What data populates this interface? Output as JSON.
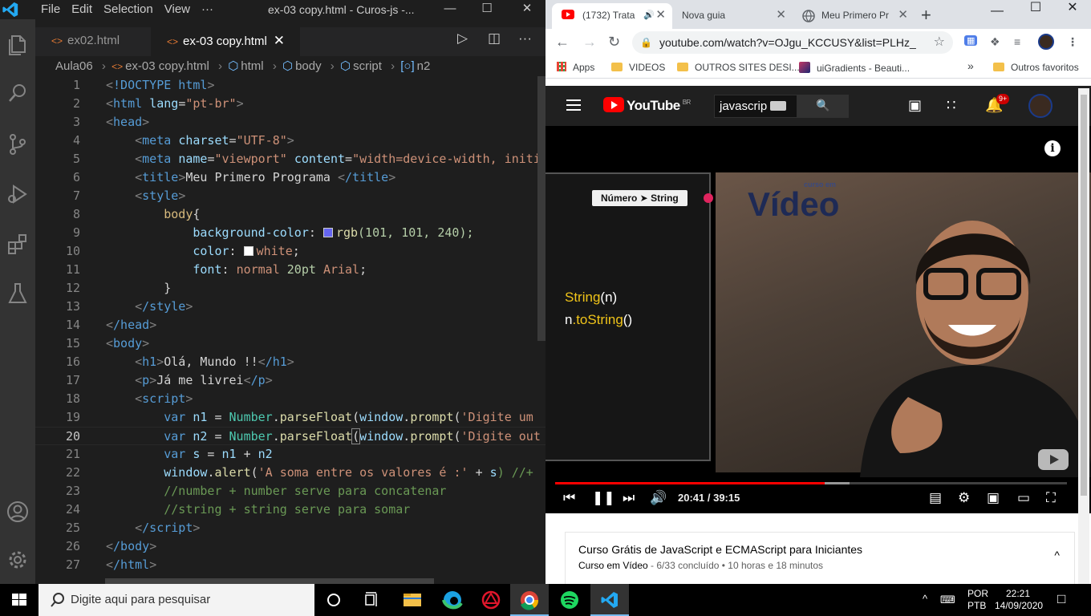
{
  "vscode": {
    "menu": [
      "File",
      "Edit",
      "Selection",
      "View",
      "···"
    ],
    "window_title": "ex-03 copy.html - Curos-js -...",
    "tabs": [
      {
        "label": "ex02.html",
        "active": false
      },
      {
        "label": "ex-03 copy.html",
        "active": true
      }
    ],
    "breadcrumb": [
      "Aula06",
      "ex-03 copy.html",
      "html",
      "body",
      "script",
      "n2"
    ],
    "current_line": 20,
    "lines": [
      {
        "n": "1"
      },
      {
        "n": "2"
      },
      {
        "n": "3"
      },
      {
        "n": "4"
      },
      {
        "n": "5"
      },
      {
        "n": "6"
      },
      {
        "n": "7"
      },
      {
        "n": "8"
      },
      {
        "n": "9"
      },
      {
        "n": "10"
      },
      {
        "n": "11"
      },
      {
        "n": "12"
      },
      {
        "n": "13"
      },
      {
        "n": "14"
      },
      {
        "n": "15"
      },
      {
        "n": "16"
      },
      {
        "n": "17"
      },
      {
        "n": "18"
      },
      {
        "n": "19"
      },
      {
        "n": "20"
      },
      {
        "n": "21"
      },
      {
        "n": "22"
      },
      {
        "n": "23"
      },
      {
        "n": "24"
      },
      {
        "n": "25"
      },
      {
        "n": "26"
      },
      {
        "n": "27"
      }
    ],
    "code": {
      "l1": "!DOCTYPE html",
      "l2_tag": "html",
      "l2_attr": "lang",
      "l2_val": "\"pt-br\"",
      "l3": "head",
      "l4_tag": "meta",
      "l4_attr": "charset",
      "l4_val": "\"UTF-8\"",
      "l5_tag": "meta",
      "l5_a1": "name",
      "l5_v1": "\"viewport\"",
      "l5_a2": "content",
      "l5_v2": "\"width=device-width, initi",
      "l6_tag": "title",
      "l6_text": "Meu Primero Programa ",
      "l6_close": "/title",
      "l7": "style",
      "l8_sel": "body",
      "l8_brace": "{",
      "l9_prop": "background-color",
      "l9_fn": "rgb",
      "l9_args": "(101, 101, 240);",
      "l9_swatch": "#6565f0",
      "l10_prop": "color",
      "l10_val": "white",
      "l10_end": ";",
      "l10_swatch": "#ffffff",
      "l11_prop": "font",
      "l11_v1": "normal",
      "l11_v2": "20pt",
      "l11_v3": "Arial",
      "l11_end": ";",
      "l12": "}",
      "l13": "/style",
      "l14": "/head",
      "l15": "body",
      "l16_tag": "h1",
      "l16_text": "Olá, Mundo !!",
      "l16_close": "/h1",
      "l17_tag": "p",
      "l17_text": "Já me livrei",
      "l17_close": "/p",
      "l18": "script",
      "l19_kw": "var",
      "l19_var": "n1",
      "l19_op": " = ",
      "l19_cls": "Number",
      "l19_fn": "parseFloat",
      "l19_obj": "window",
      "l19_fn2": "prompt",
      "l19_str": "'Digite um",
      "l20_kw": "var",
      "l20_var": "n2",
      "l20_op": " = ",
      "l20_cls": "Number",
      "l20_fn": "parseFloat",
      "l20_obj": "window",
      "l20_fn2": "prompt",
      "l20_str": "'Digite out",
      "l21_kw": "var",
      "l21_var": "s",
      "l21_op": " = ",
      "l21_a": "n1",
      "l21_plus": " + ",
      "l21_b": "n2",
      "l22_obj": "window",
      "l22_fn": "alert",
      "l22_str": "'A soma entre os valores é :'",
      "l22_plus": " + ",
      "l22_var": "s",
      "l22_rest": ") //+",
      "l23": "//number + number serve para concatenar",
      "l24": "//string + string serve para somar",
      "l25": "/script",
      "l26": "/body",
      "l27": "/html"
    }
  },
  "chrome": {
    "tabs": [
      {
        "label": "(1732) Trata",
        "audio": "🔊",
        "active": true
      },
      {
        "label": "Nova guia",
        "active": false
      },
      {
        "label": "Meu Primero Pr",
        "active": false
      }
    ],
    "url": "youtube.com/watch?v=OJgu_KCCUSY&list=PLHz_...",
    "bookmarks": [
      "Apps",
      "VIDEOS",
      "OUTROS SITES DESI...",
      "uiGradients - Beauti...",
      "»",
      "Outros favoritos"
    ],
    "youtube": {
      "logo": "YouTube",
      "region": "BR",
      "search_value": "javascrip",
      "notification_count": "9+",
      "video": {
        "tag": "Número ➤ String",
        "code_line1_fn": "String",
        "code_line1_arg": "(n)",
        "code_line2_obj": "n",
        "code_line2_fn": ".toString",
        "code_line2_end": "()",
        "brand_small": "curso em",
        "brand": "Vídeo"
      },
      "time_current": "20:41",
      "time_total": "39:15",
      "progress_fraction": 0.527,
      "buffered_fraction": 0.575,
      "playlist_title": "Curso Grátis de JavaScript e ECMAScript para Iniciantes",
      "playlist_channel": "Curso em Vídeo",
      "playlist_meta": " - 6/33 concluído • 10 horas e 18 minutos"
    }
  },
  "taskbar": {
    "search_placeholder": "Digite aqui para pesquisar",
    "language": "POR",
    "layout": "PTB",
    "time": "22:21",
    "date": "14/09/2020"
  },
  "colors": {
    "vscode_bg": "#1e1e1e",
    "youtube_red": "#ff0000",
    "taskbar": "#000000"
  }
}
